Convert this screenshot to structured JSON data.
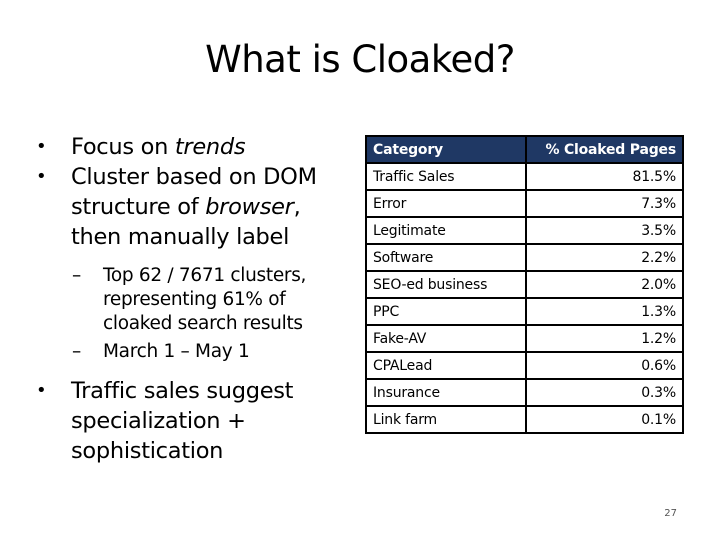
{
  "slide": {
    "title": "What is Cloaked?",
    "page_number": "27"
  },
  "bullets": [
    {
      "segments": [
        {
          "text": "Focus on ",
          "italic": false
        },
        {
          "text": "trends",
          "italic": true
        }
      ]
    },
    {
      "segments": [
        {
          "text": "Cluster based on DOM structure of ",
          "italic": false
        },
        {
          "text": "browser",
          "italic": true
        },
        {
          "text": ", then manually label",
          "italic": false
        }
      ],
      "sub_bullets": [
        "Top 62 / 7671 clusters, representing 61% of cloaked search results",
        "March 1 – May 1"
      ]
    },
    {
      "segments": [
        {
          "text": "Traffic sales suggest specialization + sophistication",
          "italic": false
        }
      ]
    }
  ],
  "table": {
    "header_color": "#1F3864",
    "columns": [
      "Category",
      "% Cloaked Pages"
    ],
    "rows": [
      {
        "category": "Traffic Sales",
        "percent": "81.5%"
      },
      {
        "category": "Error",
        "percent": "7.3%"
      },
      {
        "category": "Legitimate",
        "percent": "3.5%"
      },
      {
        "category": "Software",
        "percent": "2.2%"
      },
      {
        "category": "SEO-ed business",
        "percent": "2.0%"
      },
      {
        "category": "PPC",
        "percent": "1.3%"
      },
      {
        "category": "Fake-AV",
        "percent": "1.2%"
      },
      {
        "category": "CPALead",
        "percent": "0.6%"
      },
      {
        "category": "Insurance",
        "percent": "0.3%"
      },
      {
        "category": "Link farm",
        "percent": "0.1%"
      }
    ]
  }
}
